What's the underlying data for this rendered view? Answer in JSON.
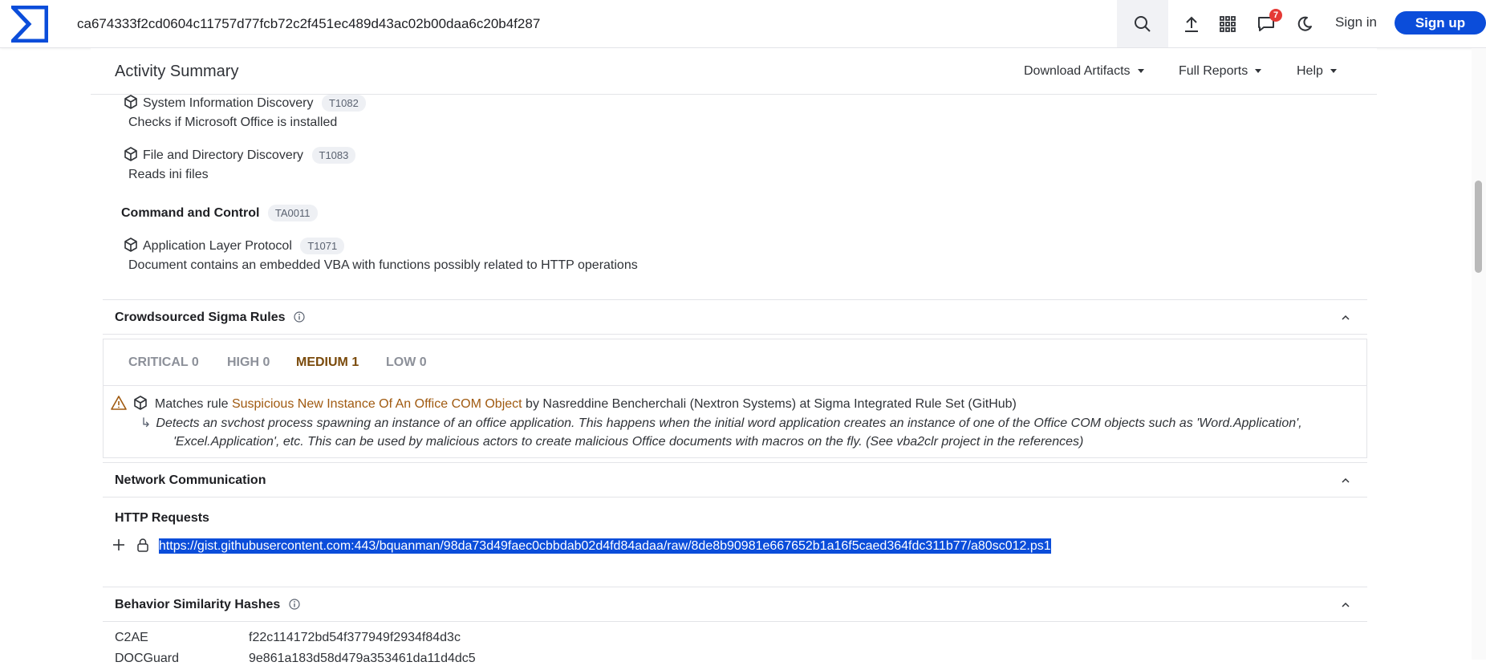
{
  "app": {
    "brand_color": "#0b4dda",
    "search_value": "ca674333f2cd0604c11757d77fcb72c2f451ec489d43ac02b00daa6c20b4f287",
    "notification_count": "7",
    "signin_label": "Sign in",
    "signup_label": "Sign up"
  },
  "activity": {
    "title": "Activity Summary",
    "menus": [
      "Download Artifacts",
      "Full Reports",
      "Help"
    ]
  },
  "techniques": [
    {
      "name": "System Information Discovery",
      "id": "T1082",
      "desc": "Checks if Microsoft Office is installed"
    },
    {
      "name": "File and Directory Discovery",
      "id": "T1083",
      "desc": "Reads ini files"
    }
  ],
  "tactic": {
    "name": "Command and Control",
    "id": "TA0011"
  },
  "technique_c2": {
    "name": "Application Layer Protocol",
    "id": "T1071",
    "desc": "Document contains an embedded VBA with functions possibly related to HTTP operations"
  },
  "sigma": {
    "title": "Crowdsourced Sigma Rules",
    "tabs": [
      "CRITICAL 0",
      "HIGH 0",
      "MEDIUM 1",
      "LOW 0"
    ],
    "active_tab_color": "#7a4a0b",
    "rule_prefix": "Matches rule",
    "rule_name": "Suspicious New Instance Of An Office COM Object",
    "rule_suffix": "by Nasreddine Bencherchali (Nextron Systems) at Sigma Integrated Rule Set (GitHub)",
    "rule_desc_line1": "Detects an svchost process spawning an instance of an office application. This happens when the initial word application creates an instance of one of the Office COM objects such as 'Word.Application',",
    "rule_desc_line2": "'Excel.Application', etc. This can be used by malicious actors to create malicious Office documents with macros on the fly. (See vba2clr project in the references)"
  },
  "network": {
    "title": "Network Communication",
    "http_title": "HTTP Requests",
    "url": "https://gist.githubusercontent.com:443/bquanman/98da73d49faec0cbbdab02d4fd84adaa/raw/8de8b90981e667652b1a16f5caed364fdc311b77/a80sc012.ps1"
  },
  "behavior": {
    "title": "Behavior Similarity Hashes",
    "rows": [
      {
        "key": "C2AE",
        "value": "f22c114172bd54f377949f2934f84d3c"
      },
      {
        "key": "DOCGuard",
        "value": "9e861a183d58d479a353461da11d4dc5"
      }
    ]
  }
}
